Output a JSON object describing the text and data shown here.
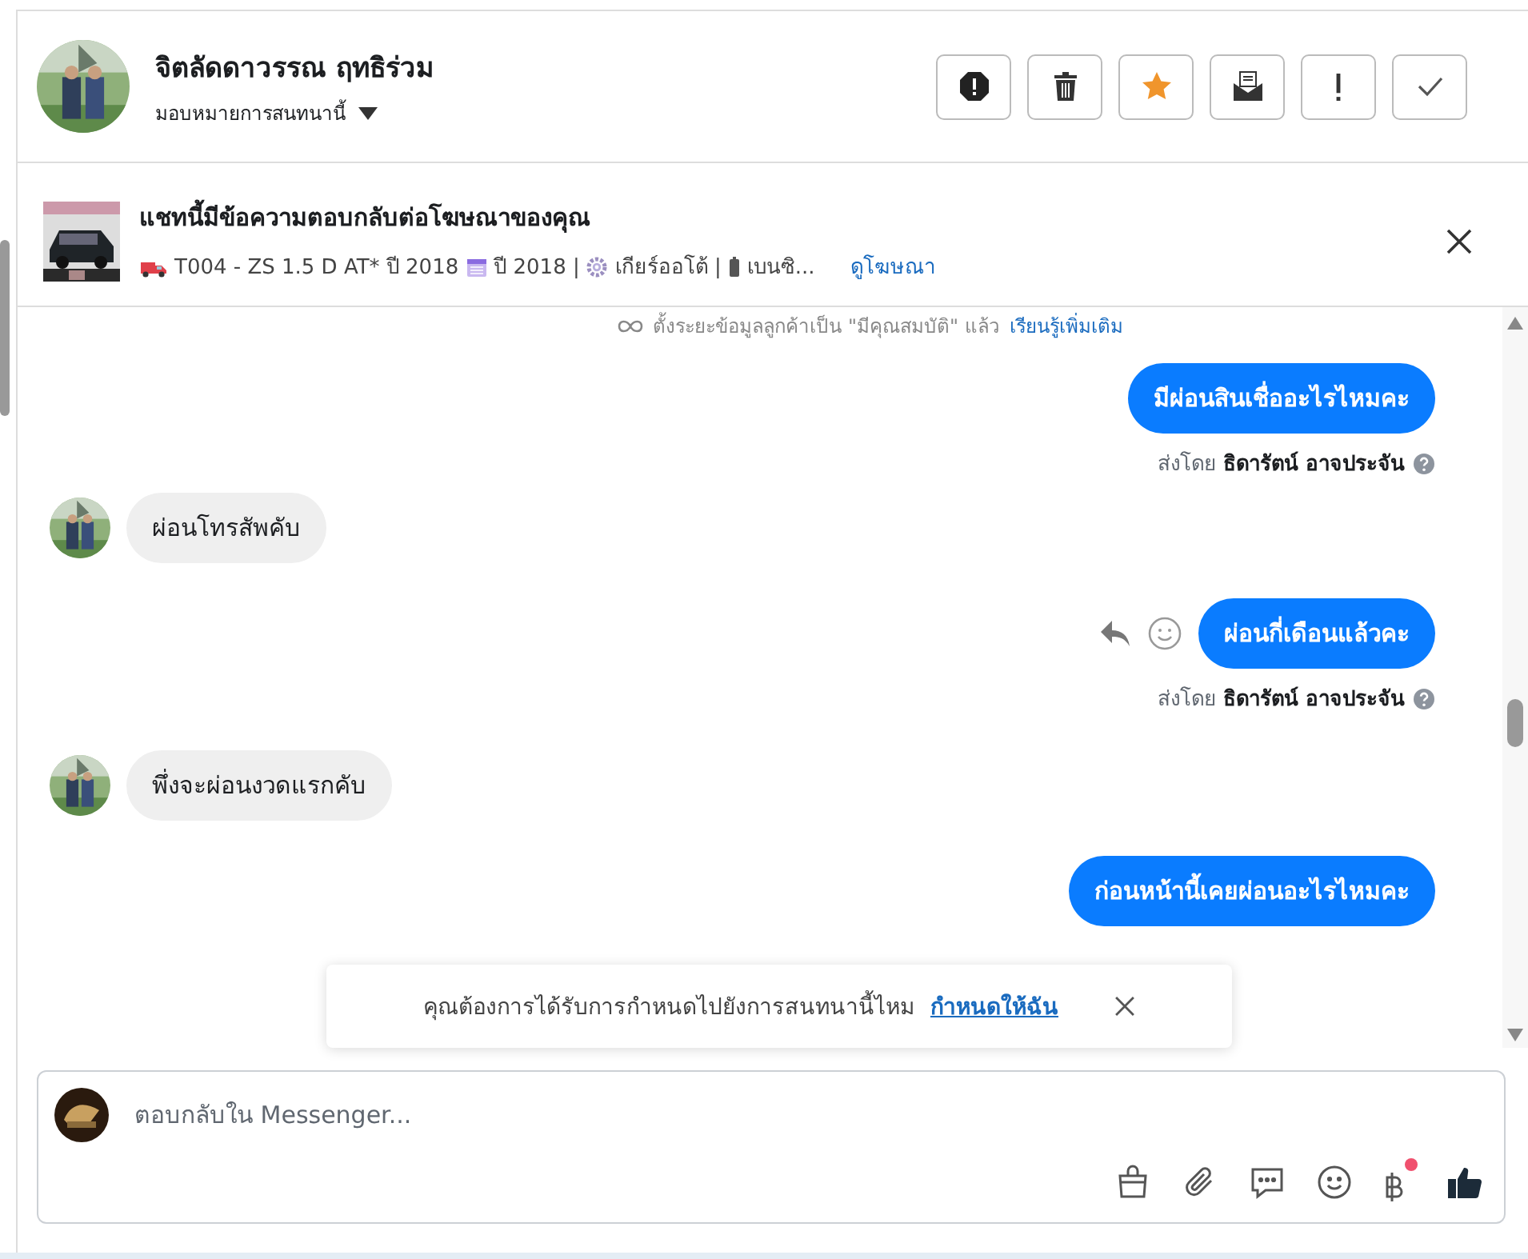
{
  "header": {
    "name": "จิตลัดดาวรรณ ฤทธิร่วม",
    "assign_label": "มอบหมายการสนทนานี้",
    "actions": [
      {
        "kind": "alert"
      },
      {
        "kind": "trash"
      },
      {
        "kind": "star"
      },
      {
        "kind": "mail"
      },
      {
        "kind": "exclaim"
      },
      {
        "kind": "check"
      }
    ]
  },
  "ad_banner": {
    "title": "แชทนี้มีข้อความตอบกลับต่อโฆษณาของคุณ",
    "details": [
      {
        "kind": "truck",
        "text": "T004 - ZS 1.5 D AT* ปี 2018"
      },
      {
        "kind": "calendar",
        "text": "ปี 2018 |"
      },
      {
        "kind": "gear",
        "text": "เกียร์ออโต้ |"
      },
      {
        "kind": "fuel",
        "text": "เบนซิ..."
      }
    ],
    "link": "ดูโฆษณา"
  },
  "notice": {
    "text": "ตั้งระยะข้อมูลลูกค้าเป็น \"มีคุณสมบัติ\" แล้ว",
    "link": "เรียนรู้เพิ่มเติม"
  },
  "messages": [
    {
      "kind": "outgoing",
      "text": "มีผ่อนสินเชื่ออะไรไหมคะ",
      "sent_by": "ส่งโดย",
      "sender": "ธิดารัตน์ อาจประจัน",
      "hovered": false
    },
    {
      "kind": "incoming",
      "text": "ผ่อนโทรสัพคับ"
    },
    {
      "kind": "outgoing",
      "text": "ผ่อนกี่เดือนแล้วคะ",
      "sent_by": "ส่งโดย",
      "sender": "ธิดารัตน์ อาจประจัน",
      "hovered": true
    },
    {
      "kind": "incoming",
      "text": "พึ่งจะผ่อนงวดแรกคับ"
    },
    {
      "kind": "outgoing",
      "text": "ก่อนหน้านี้เคยผ่อนอะไรไหมคะ"
    }
  ],
  "toast": {
    "text": "คุณต้องการได้รับการกำหนดไปยังการสนทนานี้ไหม",
    "link": "กำหนดให้ฉัน"
  },
  "composer": {
    "placeholder": "ตอบกลับใน Messenger...",
    "tools": [
      {
        "kind": "bag",
        "badge": false
      },
      {
        "kind": "clip",
        "badge": false
      },
      {
        "kind": "chat",
        "badge": false
      },
      {
        "kind": "smile",
        "badge": false
      },
      {
        "kind": "baht",
        "badge": true
      },
      {
        "kind": "like",
        "badge": false
      }
    ]
  }
}
